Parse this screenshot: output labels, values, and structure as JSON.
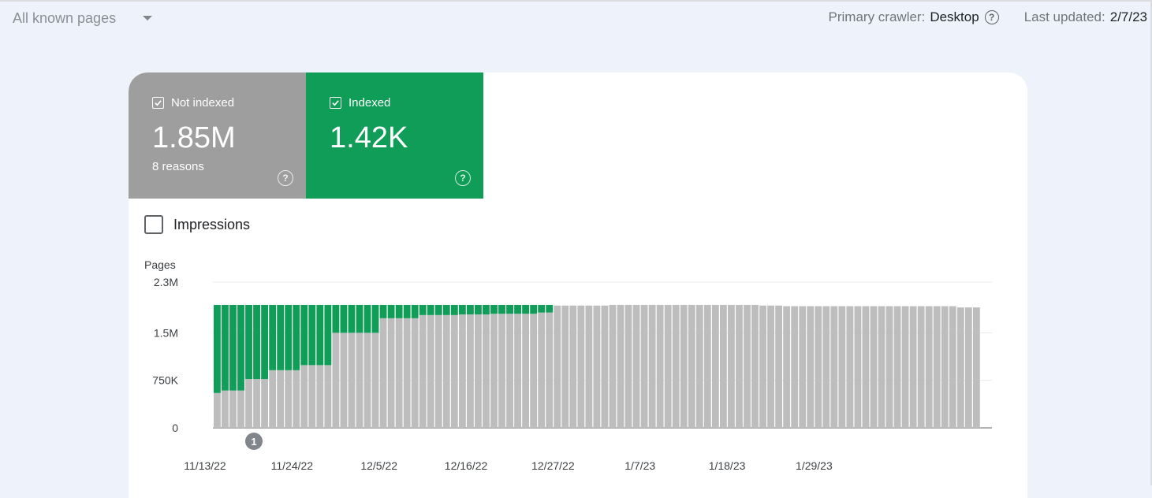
{
  "header": {
    "pages_select": "All known pages",
    "crawler_label": "Primary crawler:",
    "crawler_value": "Desktop",
    "updated_label": "Last updated:",
    "updated_value": "2/7/23"
  },
  "tiles": {
    "not_indexed": {
      "label": "Not indexed",
      "value": "1.85M",
      "sub": "8 reasons",
      "color": "#9e9e9e"
    },
    "indexed": {
      "label": "Indexed",
      "value": "1.42K",
      "color": "#0f9d58"
    }
  },
  "impressions_label": "Impressions",
  "annotation_marker": "1",
  "chart_data": {
    "type": "bar",
    "stacked": true,
    "ylabel": "Pages",
    "ylim": [
      0,
      2300000
    ],
    "yticks": [
      {
        "value": 0,
        "label": "0"
      },
      {
        "value": 750000,
        "label": "750K"
      },
      {
        "value": 1500000,
        "label": "1.5M"
      },
      {
        "value": 2300000,
        "label": "2.3M"
      }
    ],
    "x_tick_labels": [
      "11/13/22",
      "11/24/22",
      "12/5/22",
      "12/16/22",
      "12/27/22",
      "1/7/23",
      "1/18/23",
      "1/29/23"
    ],
    "x_tick_index": [
      0,
      11,
      22,
      33,
      44,
      55,
      66,
      77
    ],
    "grid": true,
    "series": [
      {
        "name": "Not indexed",
        "color": "#bdbdbd",
        "values": [
          550000,
          590000,
          590000,
          590000,
          770000,
          770000,
          770000,
          910000,
          910000,
          910000,
          910000,
          990000,
          990000,
          990000,
          990000,
          1500000,
          1500000,
          1500000,
          1500000,
          1500000,
          1500000,
          1730000,
          1730000,
          1730000,
          1730000,
          1730000,
          1780000,
          1780000,
          1780000,
          1780000,
          1780000,
          1790000,
          1790000,
          1790000,
          1790000,
          1800000,
          1800000,
          1800000,
          1800000,
          1800000,
          1800000,
          1820000,
          1820000,
          1930000,
          1930000,
          1930000,
          1930000,
          1930000,
          1930000,
          1930000,
          1940000,
          1940000,
          1940000,
          1940000,
          1940000,
          1940000,
          1940000,
          1940000,
          1940000,
          1940000,
          1940000,
          1940000,
          1940000,
          1940000,
          1940000,
          1940000,
          1940000,
          1940000,
          1940000,
          1930000,
          1930000,
          1930000,
          1920000,
          1920000,
          1920000,
          1920000,
          1920000,
          1920000,
          1920000,
          1920000,
          1920000,
          1920000,
          1920000,
          1920000,
          1920000,
          1920000,
          1920000,
          1920000,
          1920000,
          1920000,
          1920000,
          1920000,
          1920000,
          1920000,
          1900000,
          1900000,
          1900000
        ]
      },
      {
        "name": "Indexed",
        "color": "#0f9d58",
        "values": [
          1390000,
          1350000,
          1350000,
          1350000,
          1170000,
          1170000,
          1170000,
          1030000,
          1030000,
          1030000,
          1030000,
          950000,
          950000,
          950000,
          950000,
          440000,
          440000,
          440000,
          440000,
          440000,
          440000,
          210000,
          210000,
          210000,
          210000,
          210000,
          160000,
          160000,
          160000,
          160000,
          160000,
          150000,
          150000,
          150000,
          150000,
          140000,
          140000,
          140000,
          140000,
          140000,
          140000,
          120000,
          120000,
          0,
          0,
          0,
          0,
          0,
          0,
          0,
          0,
          0,
          0,
          0,
          0,
          0,
          0,
          0,
          0,
          0,
          0,
          0,
          0,
          0,
          0,
          0,
          0,
          0,
          0,
          0,
          0,
          0,
          0,
          0,
          0,
          0,
          0,
          0,
          0,
          0,
          0,
          0,
          0,
          0,
          0,
          0,
          0,
          0,
          0,
          0,
          0,
          0,
          0,
          0,
          0,
          0,
          0
        ]
      }
    ]
  }
}
